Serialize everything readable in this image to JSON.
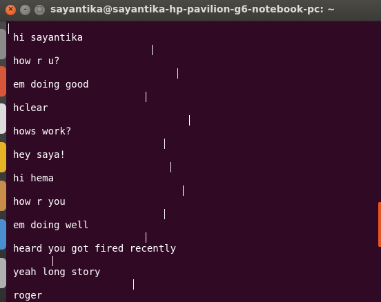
{
  "window": {
    "title": "sayantika@sayantika-hp-pavilion-g6-notebook-pc: ~",
    "close_glyph": "×",
    "minimize_glyph": "–",
    "maximize_glyph": "□"
  },
  "terminal": {
    "lines": [
      "hi sayantika",
      "how r u?",
      "em doing good",
      "hclear",
      "hows work?",
      "hey saya!",
      "hi hema",
      "how r you",
      "em doing well",
      "heard you got fired recently",
      "yeah long story",
      "roger"
    ],
    "cursor_char": "|"
  },
  "colors": {
    "terminal_background": "#300a24",
    "terminal_text": "#ffffff",
    "titlebar": "#3c3b37",
    "accent": "#e95420"
  }
}
